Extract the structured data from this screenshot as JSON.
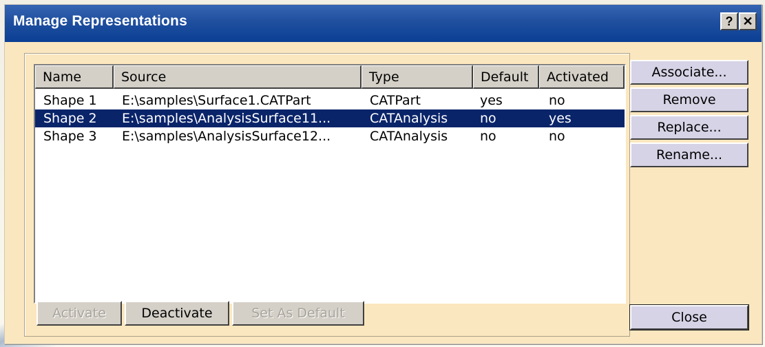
{
  "window": {
    "title": "Manage Representations",
    "help_glyph": "?",
    "close_glyph": "✕"
  },
  "list": {
    "columns": [
      "Name",
      "Source",
      "Type",
      "Default",
      "Activated"
    ],
    "rows": [
      {
        "name": "Shape 1",
        "source": "E:\\samples\\Surface1.CATPart",
        "type": "CATPart",
        "default": "yes",
        "activated": "no",
        "selected": false
      },
      {
        "name": "Shape 2",
        "source": "E:\\samples\\AnalysisSurface11...",
        "type": "CATAnalysis",
        "default": "no",
        "activated": "yes",
        "selected": true
      },
      {
        "name": "Shape 3",
        "source": "E:\\samples\\AnalysisSurface12...",
        "type": "CATAnalysis",
        "default": "no",
        "activated": "no",
        "selected": false
      }
    ]
  },
  "bottom_buttons": {
    "activate": "Activate",
    "deactivate": "Deactivate",
    "set_as_default": "Set As Default"
  },
  "side_buttons": {
    "associate": "Associate...",
    "remove": "Remove",
    "replace": "Replace...",
    "rename": "Rename...",
    "close": "Close"
  },
  "colors": {
    "title_bar": "#0b3f95",
    "dialog_bg": "#fbe7bf",
    "selection": "#0a246a"
  }
}
